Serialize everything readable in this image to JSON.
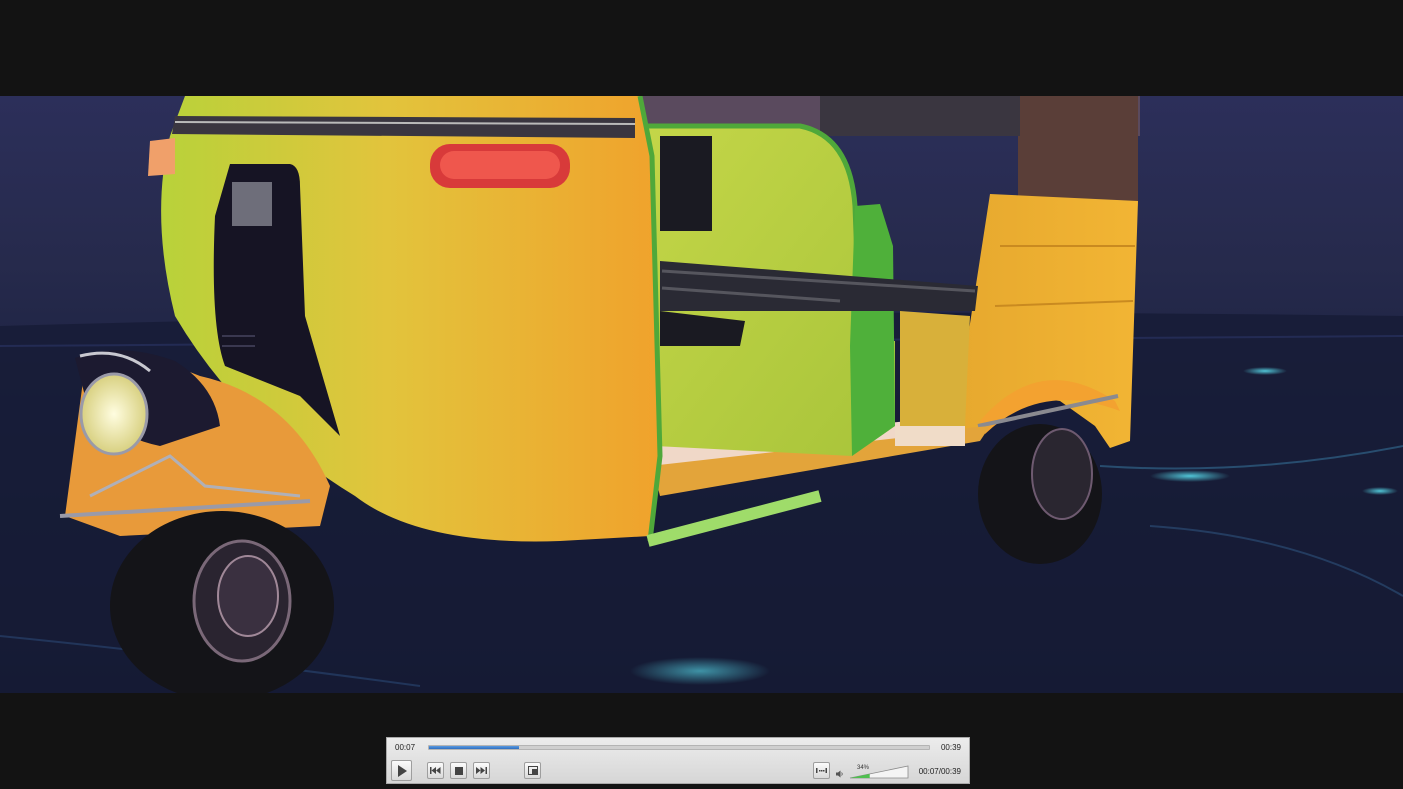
{
  "player": {
    "elapsed": "00:07",
    "duration": "00:39",
    "time_readout": "00:07/00:39",
    "progress": 0.18,
    "volume_label": "34%",
    "volume": 0.34
  },
  "controls": {
    "play_icon": "play-icon",
    "prev_icon": "skip-back-icon",
    "stop_icon": "stop-icon",
    "next_icon": "skip-forward-icon",
    "fullscreen_icon": "fullscreen-icon",
    "extended_icon": "extended-settings-icon",
    "volume_icon": "speaker-icon"
  },
  "colors": {
    "seek_fill": "#2f6fbf",
    "volume_fill": "#4fbf4f",
    "background": "#131313"
  }
}
